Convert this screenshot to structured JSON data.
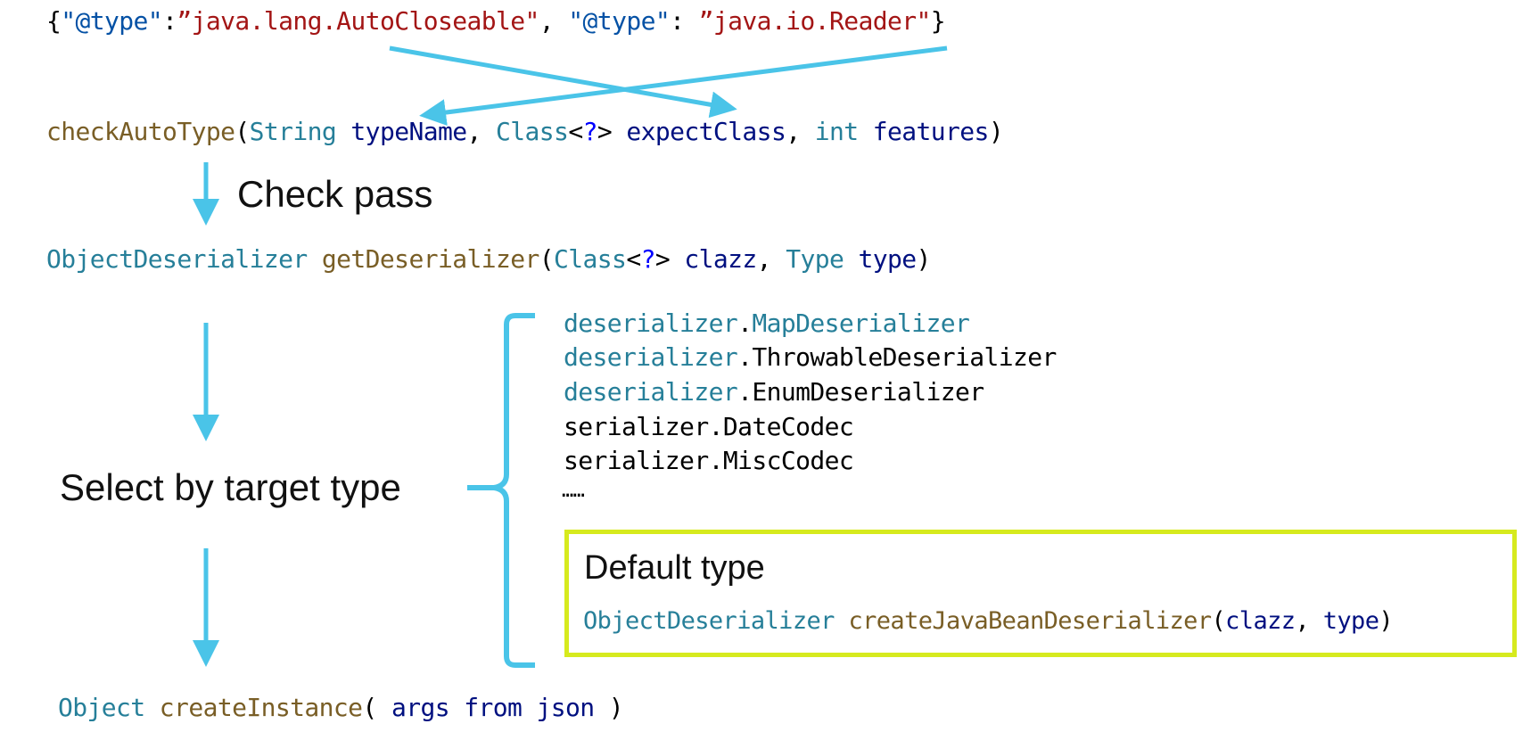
{
  "json_line": {
    "open": "{",
    "key1": "\"@type\"",
    "colon1": ":",
    "value1": "”java.lang.AutoCloseable\"",
    "sep": ", ",
    "key2": "\"@type\"",
    "colon2": ": ",
    "value2": "”java.io.Reader\"",
    "close": "}"
  },
  "check_auto_type": {
    "method": "checkAutoType",
    "open": "(",
    "t1": "String",
    "p1": " typeName",
    "c1": ", ",
    "t2": "Class",
    "lt": "<",
    "q": "?",
    "gt": ">",
    "p2": " expectClass",
    "c2": ", ",
    "t3": "int",
    "p3": " features",
    "close": ")"
  },
  "check_pass_label": "Check pass",
  "get_deserializer": {
    "ret": "ObjectDeserializer",
    "method": " getDeserializer",
    "open": "(",
    "t1": "Class",
    "lt": "<",
    "q": "?",
    "gt": ">",
    "p1": " clazz",
    "c1": ", ",
    "t2": "Type",
    "p2": " type",
    "close": ")"
  },
  "select_label": "Select by target type",
  "deserializers": [
    {
      "pkg": "deserializer",
      "dot": ".",
      "name": "MapDeserializer"
    },
    {
      "pkg": "deserializer",
      "dot": ".",
      "name": "ThrowableDeserializer"
    },
    {
      "pkg": "deserializer",
      "dot": ".",
      "name": "EnumDeserializer"
    },
    {
      "pkg": "serializer",
      "dot": ".",
      "name": "DateCodec"
    },
    {
      "pkg": "serializer",
      "dot": ".",
      "name": "MiscCodec"
    }
  ],
  "ellipsis": "……",
  "default_box": {
    "title": "Default type",
    "ret": "ObjectDeserializer",
    "method": " createJavaBeanDeserializer",
    "open": "(",
    "a1": "clazz",
    "comma": ", ",
    "a2": "type",
    "close": ")"
  },
  "create_instance": {
    "ret": "Object",
    "method": " createInstance",
    "open": "( ",
    "args": "args from json",
    "close": " )"
  },
  "colors": {
    "arrow": "#4ac4e8",
    "highlight_border": "#d6ea1e",
    "string": "#a31515",
    "key": "#0451a5",
    "method": "#795e26",
    "type": "#267f99",
    "param": "#001080"
  }
}
